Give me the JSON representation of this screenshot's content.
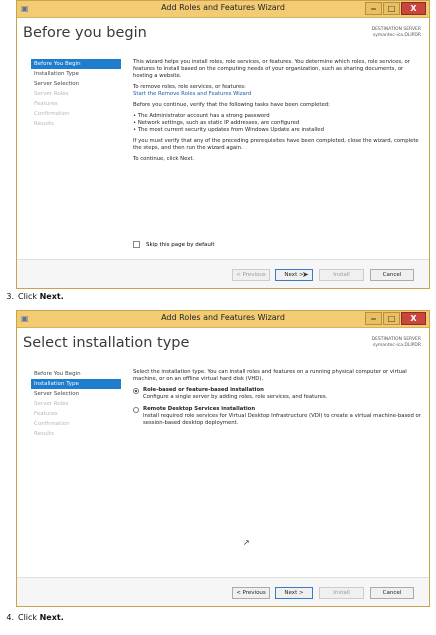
{
  "window_title": "Add Roles and Features Wizard",
  "controls": {
    "minimize": "‒",
    "maximize": "□",
    "close": "X"
  },
  "destination": {
    "label": "DESTINATION SERVER",
    "server": "symantec-ica.DLIPDR"
  },
  "nav_items": [
    "Before You Begin",
    "Installation Type",
    "Server Selection",
    "Server Roles",
    "Features",
    "Confirmation",
    "Results"
  ],
  "buttons": {
    "previous": "< Previous",
    "next": "Next >",
    "install": "Install",
    "cancel": "Cancel"
  },
  "window1": {
    "page_title": "Before you begin",
    "intro": "This wizard helps you install roles, role services, or features. You determine which roles, role services, or features to install based on the computing needs of your organization, such as sharing documents, or hosting a website.",
    "remove_text": "To remove roles, role services, or features:",
    "remove_link": "Start the Remove Roles and Features Wizard",
    "verify_text": "Before you continue, verify that the following tasks have been completed:",
    "bullets": [
      "The Administrator account has a strong password",
      "Network settings, such as static IP addresses, are configured",
      "The most current security updates from Windows Update are installed"
    ],
    "prereq_text": "If you must verify that any of the preceding prerequisites have been completed, close the wizard, complete the steps, and then run the wizard again.",
    "continue_text": "To continue, click Next.",
    "skip_label": "Skip this page by default"
  },
  "step3": {
    "number": "3.",
    "prefix": "Click ",
    "bold": "Next."
  },
  "window2": {
    "page_title": "Select installation type",
    "intro": "Select the installation type. You can install roles and features on a running physical computer or virtual machine, or on an offline virtual hard disk (VHD).",
    "option1_title": "Role-based or feature-based installation",
    "option1_desc": "Configure a single server by adding roles, role services, and features.",
    "option2_title": "Remote Desktop Services installation",
    "option2_desc": "Install required role services for Virtual Desktop Infrastructure (VDI) to create a virtual machine-based or session-based desktop deployment."
  },
  "step4": {
    "number": "4.",
    "prefix": "Click ",
    "bold": "Next."
  }
}
